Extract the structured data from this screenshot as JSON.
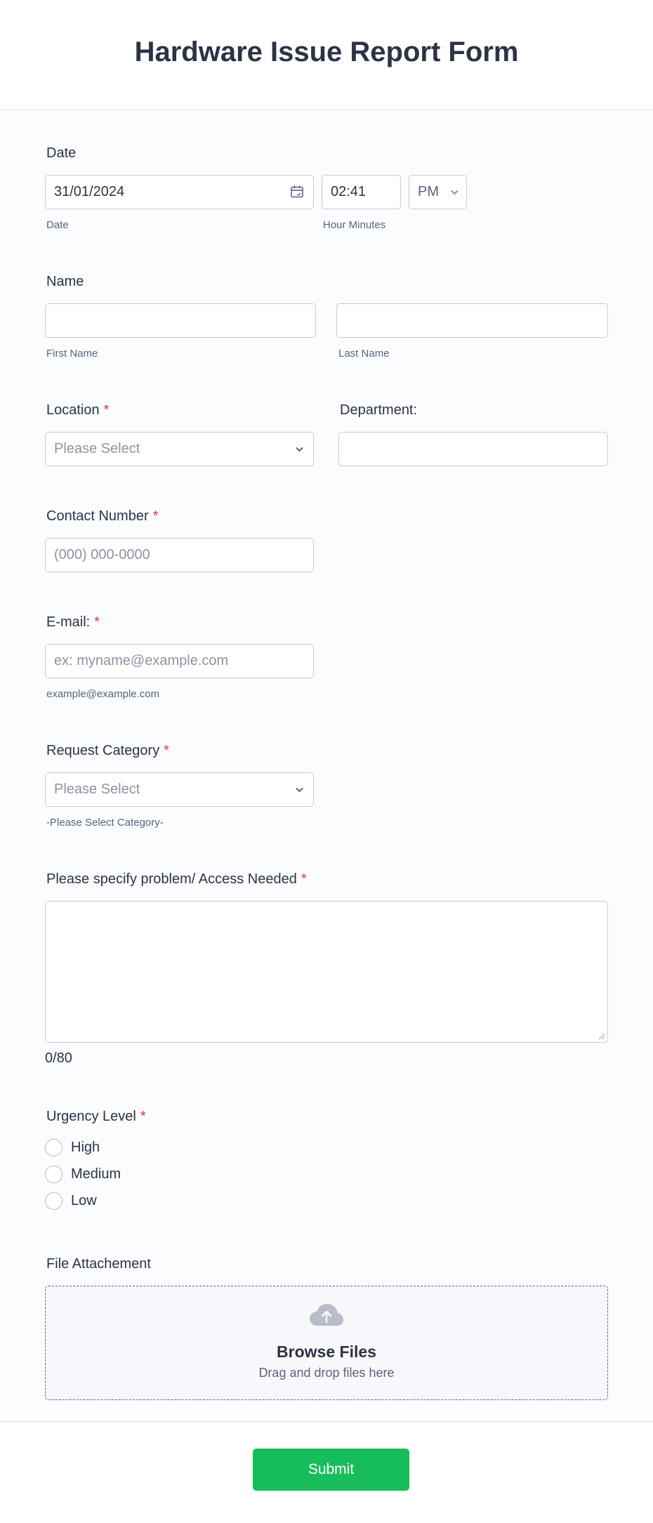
{
  "form": {
    "title": "Hardware Issue Report Form",
    "date": {
      "label": "Date",
      "value": "31/01/2024",
      "date_sublabel": "Date",
      "time_value": "02:41",
      "time_sublabel": "Hour Minutes",
      "ampm": "PM"
    },
    "name": {
      "label": "Name",
      "first_sublabel": "First Name",
      "last_sublabel": "Last Name"
    },
    "location": {
      "label": "Location",
      "required": "*",
      "placeholder": "Please Select"
    },
    "department": {
      "label": "Department:"
    },
    "contact": {
      "label": "Contact Number",
      "required": "*",
      "placeholder": "(000) 000-0000"
    },
    "email": {
      "label": "E-mail:",
      "required": "*",
      "placeholder": "ex: myname@example.com",
      "sublabel": "example@example.com"
    },
    "request_category": {
      "label": "Request Category",
      "required": "*",
      "placeholder": "Please Select",
      "sublabel": "-Please Select Category-"
    },
    "problem": {
      "label": "Please specify problem/ Access Needed",
      "required": "*",
      "counter": "0/80"
    },
    "urgency": {
      "label": "Urgency Level",
      "required": "*",
      "options": [
        "High",
        "Medium",
        "Low"
      ]
    },
    "attachment": {
      "label": "File Attachement",
      "title": "Browse Files",
      "subtitle": "Drag and drop files here"
    },
    "submit_label": "Submit"
  },
  "colors": {
    "text": "#2c3345",
    "required": "#e0364a",
    "submit": "#18bd5b",
    "border": "#c3cad8"
  },
  "icons": [
    "calendar-icon",
    "chevron-down-icon",
    "upload-cloud-icon"
  ]
}
